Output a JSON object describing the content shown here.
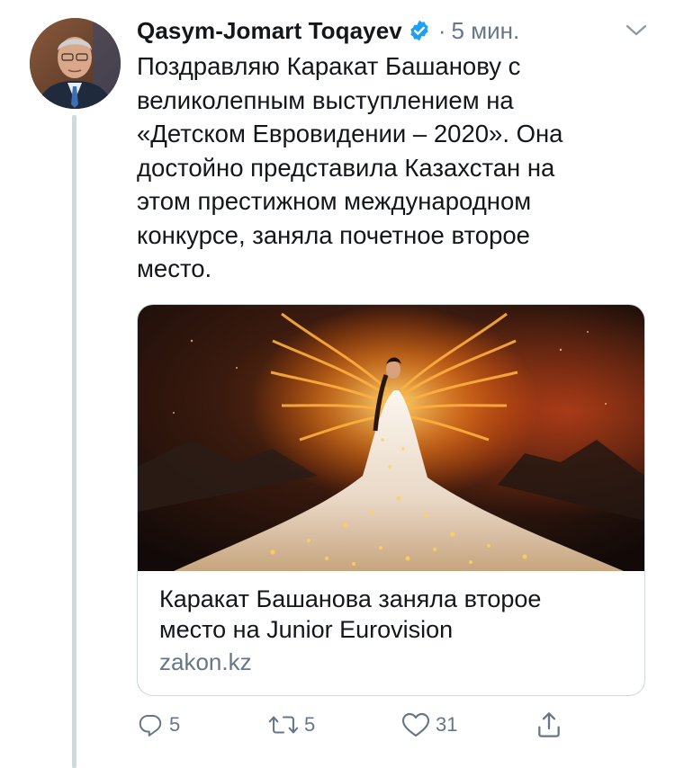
{
  "tweet": {
    "display_name": "Qasym-Jomart Toqayev",
    "separator": "·",
    "time": "5 мин.",
    "text_lines": [
      "Поздравляю Каракат Башанову с",
      "великолепным выступлением на",
      "«Детском Евровидении – 2020». Она",
      "достойно представила Казахстан на",
      "этом престижном международном",
      "конкурсе, заняла почетное второе",
      "место."
    ]
  },
  "card": {
    "title_lines": [
      "Каракат Башанова заняла второе",
      "место на Junior Eurovision"
    ],
    "domain": "zakon.kz"
  },
  "actions": {
    "reply_count": "5",
    "retweet_count": "5",
    "like_count": "31"
  },
  "colors": {
    "verified": "#1da1f2",
    "secondary_text": "#657786",
    "border": "#cfd9de"
  },
  "icons": [
    "verified-badge-icon",
    "caret-down-icon",
    "reply-icon",
    "retweet-icon",
    "like-icon",
    "share-icon"
  ]
}
